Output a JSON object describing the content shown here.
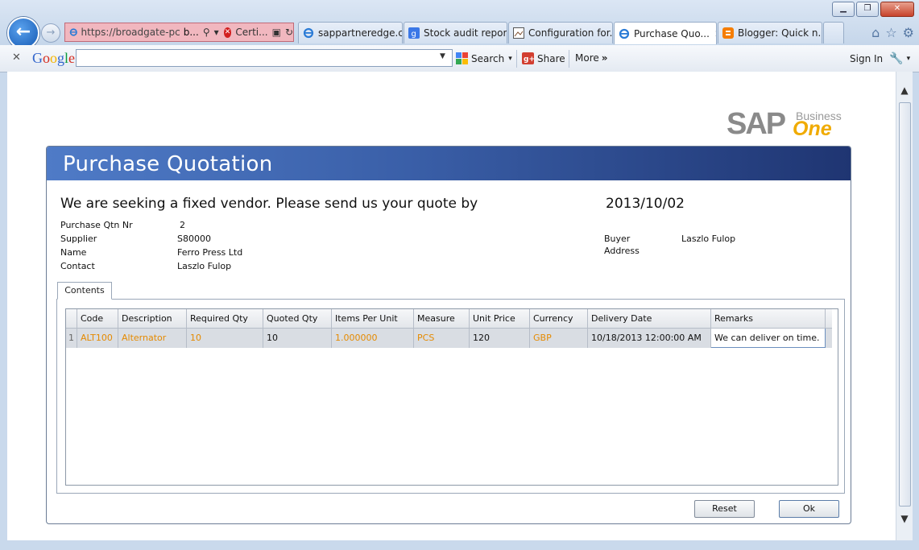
{
  "browser": {
    "address": "https://broadgate-pc",
    "address_host": "b...",
    "cert_label": "Certi...",
    "tabs": [
      {
        "label": "sappartneredge.c...",
        "icon": "ie"
      },
      {
        "label": "Stock audit repor...",
        "icon": "google"
      },
      {
        "label": "Configuration for...",
        "icon": "image"
      },
      {
        "label": "Purchase Quo...",
        "icon": "ie",
        "active": true
      },
      {
        "label": "Blogger: Quick n...",
        "icon": "blogger"
      }
    ]
  },
  "toolbar": {
    "google": "Google",
    "search_label": "Search",
    "share_label": "Share",
    "more_label": "More",
    "sign_in": "Sign In"
  },
  "logo": {
    "sap": "SAP",
    "business": "Business",
    "one": "One"
  },
  "form": {
    "title": "Purchase Quotation",
    "heading": "We are seeking a fixed vendor. Please send us your quote by",
    "date": "2013/10/02",
    "fields": {
      "qtn_label": "Purchase Qtn Nr",
      "qtn_value": "2",
      "supplier_label": "Supplier",
      "supplier_value": "S80000",
      "name_label": "Name",
      "name_value": "Ferro Press Ltd",
      "contact_label": "Contact",
      "contact_value": "Laszlo Fulop",
      "buyer_label": "Buyer",
      "buyer_value": "Laszlo Fulop",
      "address_label": "Address"
    },
    "tab_label": "Contents",
    "columns": [
      "Code",
      "Description",
      "Required Qty",
      "Quoted Qty",
      "Items Per Unit",
      "Measure",
      "Unit Price",
      "Currency",
      "Delivery Date",
      "Remarks"
    ],
    "rows": [
      {
        "num": "1",
        "code": "ALT100",
        "description": "Alternator",
        "required_qty": "10",
        "quoted_qty": "10",
        "items_per_unit": "1.000000",
        "measure": "PCS",
        "unit_price": "120",
        "currency": "GBP",
        "delivery_date": "10/18/2013 12:00:00 AM",
        "remarks": "We can deliver on time."
      }
    ],
    "reset_label": "Reset",
    "ok_label": "Ok"
  }
}
